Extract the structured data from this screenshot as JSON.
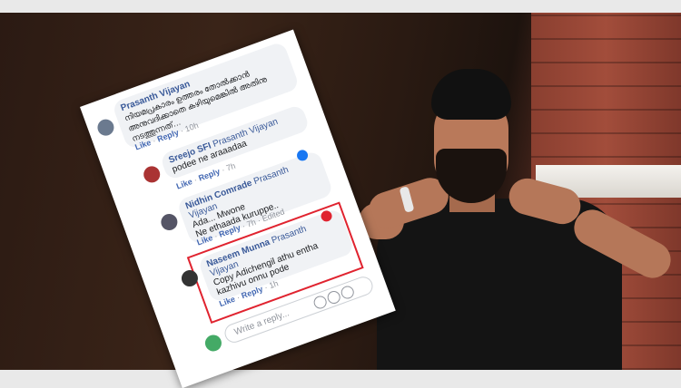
{
  "comments": [
    {
      "name": "Prasanth Vijayan",
      "text": "നിയമപ്രകാരം ഉത്തരം തോൽക്കാൻ അനുവദിക്കാതെ കഴിയുമെങ്കിൽ അതിനു നടത്തുന്നത്…",
      "actions": [
        "Like",
        "Reply"
      ],
      "time": "10h"
    },
    {
      "name": "Sreejo SFI",
      "mention": "Prasanth Vijayan",
      "text": "podee ne araaadaa",
      "actions": [
        "Like",
        "Reply"
      ],
      "time": "7h"
    },
    {
      "name": "Nidhin Comrade",
      "mention": "Prasanth Vijayan",
      "pre": "Ada... Mwone",
      "text": "Ne ethaada kuruppe..",
      "actions": [
        "Like",
        "Reply"
      ],
      "time": "7h",
      "edited": "Edited"
    },
    {
      "name": "Naseem Munna",
      "mention": "Prasanth Vijayan",
      "text": "Copy Adichengil athu entha kazhivu onnu pode",
      "actions": [
        "Like",
        "Reply"
      ],
      "time": "1h"
    }
  ],
  "write_placeholder": "Write a reply..."
}
